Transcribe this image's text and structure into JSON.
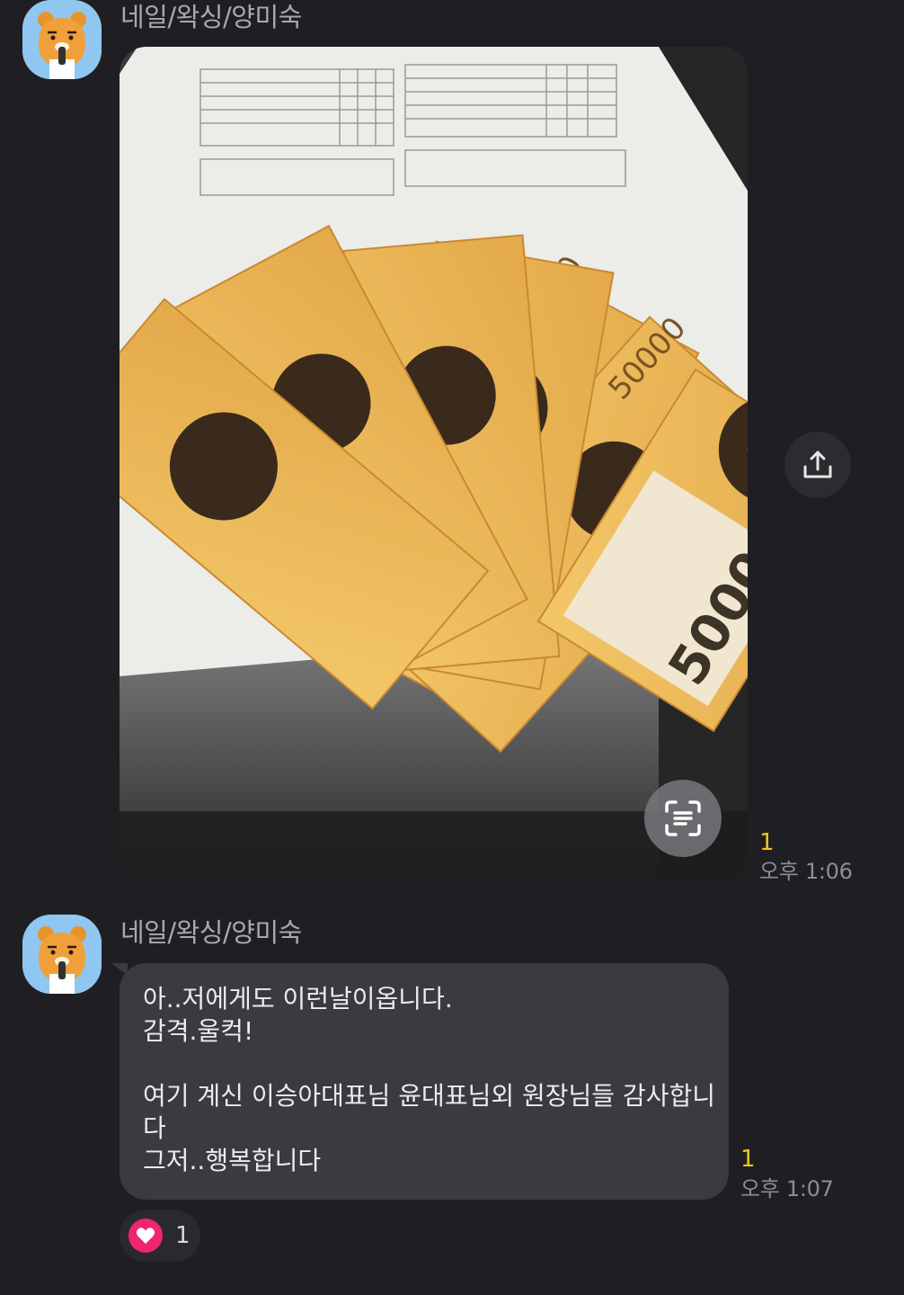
{
  "messages": [
    {
      "sender": "네일/왁싱/양미숙",
      "type": "image",
      "image_subject": "fanned-out stack of 50000 won banknotes on a printed checklist sheet",
      "unread_count": "1",
      "time": "오후 1:06"
    },
    {
      "sender": "네일/왁싱/양미숙",
      "type": "text",
      "lines": [
        "아..저에게도 이런날이옵니다.",
        "감격.울컥!",
        "",
        "여기 계신 이승아대표님 윤대표님외 원장님들 감사합니",
        "다",
        "그저..행복합니다"
      ],
      "unread_count": "1",
      "time": "오후 1:07",
      "reaction": {
        "icon": "heart-icon",
        "count": "1"
      }
    }
  ],
  "colors": {
    "background": "#1f1f23",
    "bubble": "#3b3b3f",
    "unread": "#f5c518",
    "heart": "#f0256e",
    "avatar_bg": "#8fc7f0"
  }
}
